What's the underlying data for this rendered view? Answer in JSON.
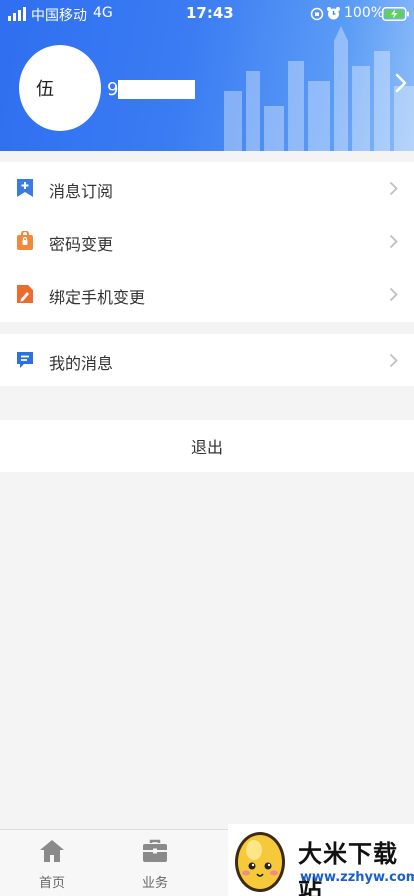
{
  "status_bar": {
    "carrier": "中国移动",
    "network": "4G",
    "time": "17:43",
    "battery": "100%"
  },
  "profile": {
    "avatar_text": "伍",
    "username_prefix": "9"
  },
  "menu": {
    "group1": [
      {
        "label": "消息订阅",
        "icon": "bookmark-plus-icon",
        "color": "#3a7be0"
      },
      {
        "label": "密码变更",
        "icon": "lock-bag-icon",
        "color": "#ef8a3c"
      },
      {
        "label": "绑定手机变更",
        "icon": "edit-doc-icon",
        "color": "#ee6b2f"
      }
    ],
    "group2": [
      {
        "label": "我的消息",
        "icon": "message-icon",
        "color": "#2d6fe5"
      }
    ],
    "logout": "退出"
  },
  "tabbar": {
    "home": "首页",
    "business": "业务"
  },
  "watermark": {
    "title": "大米下载站",
    "url": "www.zzhyw.com"
  },
  "colors": {
    "header_start": "#2f6ff0",
    "header_end": "#8fbef9",
    "background": "#f4f4f4"
  }
}
